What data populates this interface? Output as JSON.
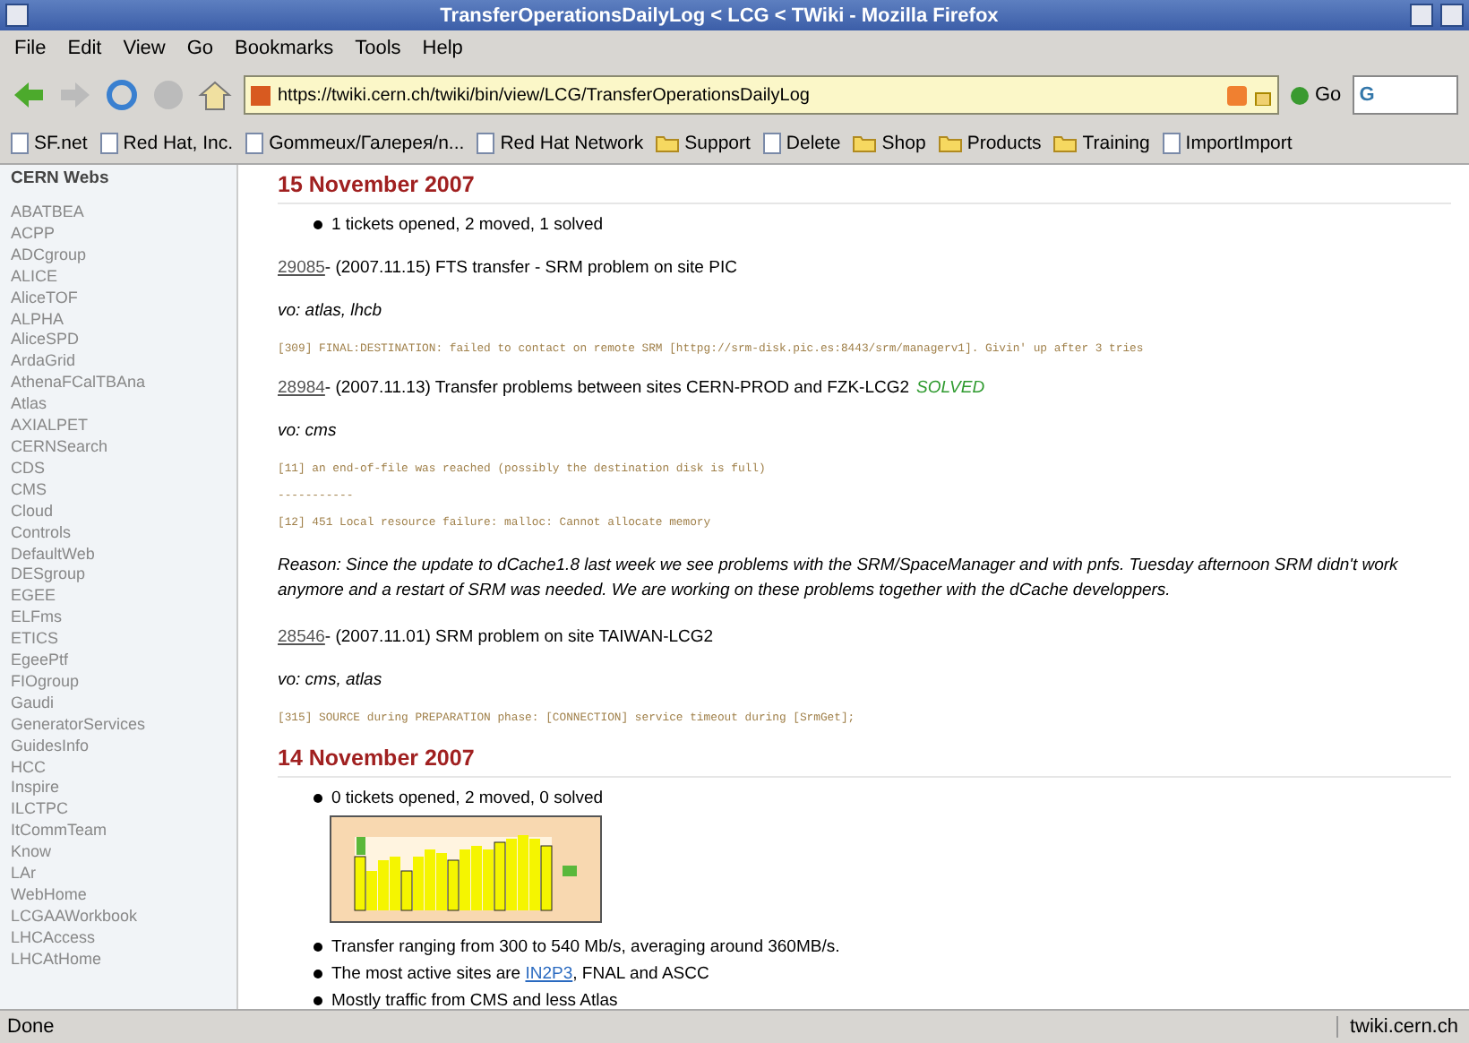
{
  "window": {
    "title": "TransferOperationsDailyLog < LCG < TWiki - Mozilla Firefox"
  },
  "menu": [
    "File",
    "Edit",
    "View",
    "Go",
    "Bookmarks",
    "Tools",
    "Help"
  ],
  "toolbar": {
    "url": "https://twiki.cern.ch/twiki/bin/view/LCG/TransferOperationsDailyLog",
    "go": "Go",
    "search_value": "G"
  },
  "bookmarks": [
    {
      "label": "SF.net",
      "kind": "page"
    },
    {
      "label": "Red Hat, Inc.",
      "kind": "page"
    },
    {
      "label": "Gommeux/Галерея/n...",
      "kind": "page"
    },
    {
      "label": "Red Hat Network",
      "kind": "page"
    },
    {
      "label": "Support",
      "kind": "folder"
    },
    {
      "label": "Delete",
      "kind": "page"
    },
    {
      "label": "Shop",
      "kind": "folder"
    },
    {
      "label": "Products",
      "kind": "folder"
    },
    {
      "label": "Training",
      "kind": "folder"
    },
    {
      "label": "ImportImport",
      "kind": "page"
    }
  ],
  "sidebar": {
    "title": "CERN Webs",
    "items": [
      "ABATBEA",
      "ACPP",
      "ADCgroup",
      "ALICE",
      "AliceTOF",
      "ALPHA",
      "AliceSPD",
      "ArdaGrid",
      "AthenaFCalTBAna",
      "Atlas",
      "AXIALPET",
      "CERNSearch",
      "CDS",
      "CMS",
      "Cloud",
      "Controls",
      "DefaultWeb",
      "DESgroup",
      "EGEE",
      "ELFms",
      "ETICS",
      "EgeePtf",
      "FIOgroup",
      "Gaudi",
      "GeneratorServices",
      "GuidesInfo",
      "HCC",
      "Inspire",
      "ILCTPC",
      "ItCommTeam",
      "Know",
      "LAr",
      "WebHome",
      "LCGAAWorkbook",
      "LHCAccess",
      "LHCAtHome"
    ]
  },
  "sections": [
    {
      "heading": "15 November 2007",
      "blocks": [
        {
          "kind": "bullet",
          "text": "1 tickets opened, 2 moved, 1 solved"
        },
        {
          "kind": "ticket",
          "id": "29085",
          "text": " - (2007.11.15) FTS transfer - SRM problem on site PIC"
        },
        {
          "kind": "vo",
          "text": "vo: atlas, lhcb"
        },
        {
          "kind": "error",
          "text": "[309] FINAL:DESTINATION: failed to contact on remote SRM [httpg://srm-disk.pic.es:8443/srm/managerv1]. Givin' up after 3 tries"
        },
        {
          "kind": "ticket",
          "id": "28984",
          "text": " - (2007.11.13) Transfer problems between sites CERN-PROD and FZK-LCG2",
          "status": "SOLVED"
        },
        {
          "kind": "vo",
          "text": "vo: cms"
        },
        {
          "kind": "error",
          "text": "[11] an end-of-file was reached (possibly the destination disk is full)"
        },
        {
          "kind": "error",
          "text": "-----------"
        },
        {
          "kind": "error",
          "text": "[12] 451 Local resource failure: malloc: Cannot allocate memory"
        },
        {
          "kind": "reason",
          "text": "Reason: Since the update to dCache1.8 last week we see problems with the SRM/SpaceManager and with pnfs. Tuesday afternoon SRM didn't work anymore and a restart of SRM was needed. We are working on these problems together with the dCache developpers."
        },
        {
          "kind": "ticket",
          "id": "28546",
          "text": " - (2007.11.01) SRM problem on site TAIWAN-LCG2"
        },
        {
          "kind": "vo",
          "text": "vo: cms, atlas"
        },
        {
          "kind": "error",
          "text": "[315] SOURCE during PREPARATION phase: [CONNECTION] service timeout during [SrmGet];"
        }
      ]
    },
    {
      "heading": "14 November 2007",
      "blocks": [
        {
          "kind": "bullet",
          "text": "0 tickets opened, 2 moved, 0 solved"
        },
        {
          "kind": "chart"
        },
        {
          "kind": "bullet",
          "text": "Transfer ranging from 300 to 540 Mb/s, averaging around 360MB/s."
        },
        {
          "kind": "bullet",
          "text": "The most active sites are ",
          "link": "IN2P3",
          "after": ", FNAL and ASCC"
        },
        {
          "kind": "bullet",
          "text": "Mostly traffic from CMS and less Atlas"
        }
      ]
    }
  ],
  "status_bar": {
    "text": "Done",
    "host": "twiki.cern.ch"
  }
}
